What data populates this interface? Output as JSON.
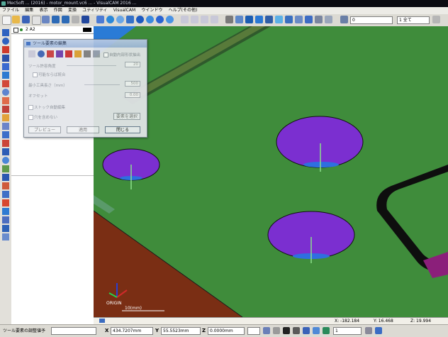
{
  "window": {
    "title": "MecSoft ... (2016) - motor_mount.vc6 ... - VisualCAM 2016 ..."
  },
  "menu": [
    "ファイル",
    "編集",
    "表示",
    "作図",
    "変換",
    "ユティリティ",
    "VisualCAM",
    "ウインドウ",
    "ヘルプ(その他)"
  ],
  "toolbar": {
    "layer_value": "0",
    "view_select": "1 全て"
  },
  "panel": {
    "layer_label": "2 A2"
  },
  "dialog": {
    "title": "ツール要素の編集",
    "check_inner_pocket": "自動内部形状抽出",
    "label_tolerance": "ツール許容角度",
    "input_tolerance": "20",
    "check_option": "可能ならば統合",
    "label_min_tool_length": "最小工具長さ（mm）",
    "input_min_tool_length": "500",
    "label_offset": "オフセット",
    "input_offset": "0.00",
    "check_stock_match": "ストック自動編集",
    "check_include_holes": "穴を含めない",
    "button_select_elements": "要素を選択",
    "button_preview": "プレビュー",
    "button_apply": "適用",
    "button_close": "閉じる"
  },
  "viewport": {
    "origin_label": "ORIGIN",
    "scale_label": "10(mm)"
  },
  "statusbar": {
    "x_readout": "X: -182.184",
    "y_readout": "Y: 16.468",
    "z_readout": "Z: 19.994"
  },
  "bottombar": {
    "prompt_label": "ツール要素の調整値予",
    "x_label": "X",
    "x_value": "434.7207mm",
    "y_label": "Y",
    "y_value": "55.5523mm",
    "z_label": "Z",
    "z_value": "0.0000mm",
    "count_value": "1"
  },
  "colors": {
    "plate_green": "#3f8c3b",
    "pocket_purple": "#7b2fd0",
    "pocket_floor_blue": "#2e6fe0",
    "brown_block": "#7a2e14",
    "blue_background": "#2a7bd6",
    "magenta_block": "#8b1f7a"
  }
}
